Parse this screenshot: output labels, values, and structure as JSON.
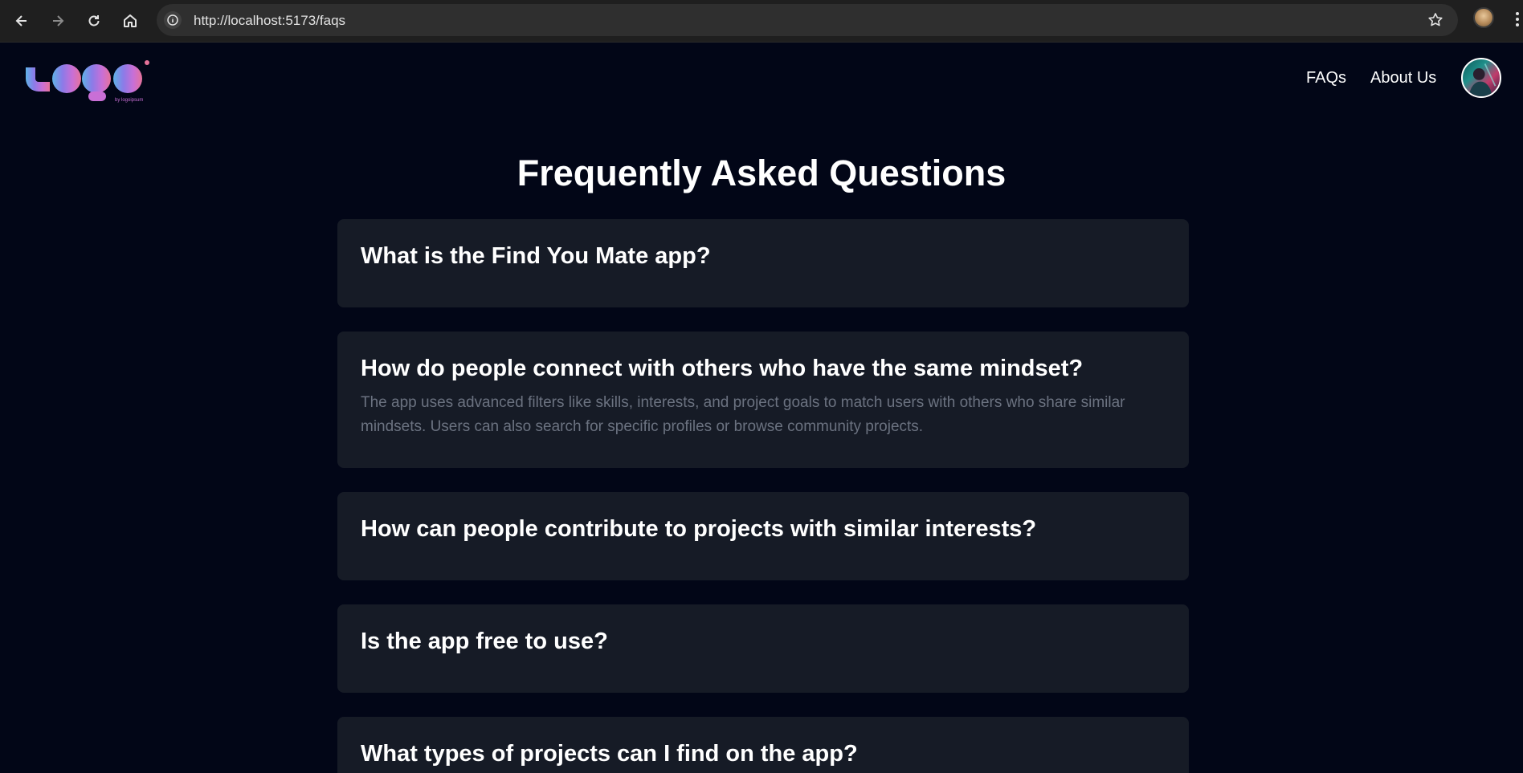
{
  "browser": {
    "url": "http://localhost:5173/faqs",
    "icons": [
      "back-arrow-icon",
      "forward-arrow-icon",
      "reload-icon",
      "home-icon",
      "site-info-icon",
      "bookmark-star-icon",
      "browser-menu-icon"
    ]
  },
  "header": {
    "logo_text": "Logo",
    "logo_subtext": "by logoipsum",
    "nav": [
      {
        "label": "FAQs"
      },
      {
        "label": "About Us"
      }
    ]
  },
  "main": {
    "title": "Frequently Asked Questions",
    "faqs": [
      {
        "question": "What is the Find You Mate app?",
        "answer": ""
      },
      {
        "question": "How do people connect with others who have the same mindset?",
        "answer": "The app uses advanced filters like skills, interests, and project goals to match users with others who share similar mindsets. Users can also search for specific profiles or browse community projects."
      },
      {
        "question": "How can people contribute to projects with similar interests?",
        "answer": ""
      },
      {
        "question": "Is the app free to use?",
        "answer": ""
      },
      {
        "question": "What types of projects can I find on the app?",
        "answer": ""
      }
    ]
  },
  "colors": {
    "background": "#020617",
    "card": "#161b26",
    "answer_text": "#6b7280",
    "logo_gradient": [
      "#5fb3e8",
      "#8b7be8",
      "#c96fd6",
      "#e6739a"
    ]
  }
}
